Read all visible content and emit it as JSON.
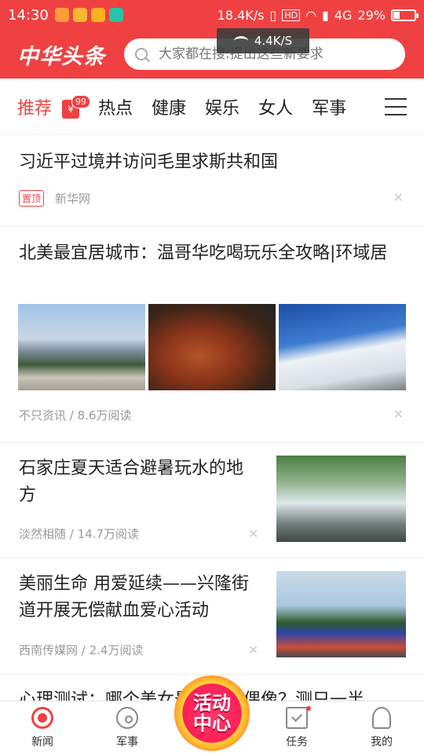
{
  "status_bar": {
    "time": "14:30",
    "net_speed": "18.4K/s",
    "network": "4G",
    "battery": "29%",
    "battery_level": 0.29
  },
  "header": {
    "logo": "中华头条",
    "search_placeholder": "大家都在搜:提出这些新要求"
  },
  "toast": {
    "speed": "4.4K/S"
  },
  "tabs": [
    {
      "label": "推荐",
      "badge": "99"
    },
    {
      "label": "热点"
    },
    {
      "label": "健康"
    },
    {
      "label": "娱乐"
    },
    {
      "label": "女人"
    },
    {
      "label": "军事"
    }
  ],
  "feed": [
    {
      "title": "习近平过境并访问毛里求斯共和国",
      "pin": "置顶",
      "source": "新华网"
    },
    {
      "title": "北美最宜居城市：温哥华吃喝玩乐全攻略|环域居",
      "meta": "不只资讯 / 8.6万阅读",
      "images": [
        "city-fountain-image",
        "bbq-image",
        "snow-hiking-image"
      ]
    },
    {
      "title": "石家庄夏天适合避暑玩水的地方",
      "meta": "淡然相随 / 14.7万阅读",
      "image": "waterfall-image"
    },
    {
      "title": "美丽生命 用爱延续——兴隆街道开展无偿献血爱心活动",
      "meta": "西南传媒网 / 2.4万阅读",
      "image": "blood-donation-tent-image"
    },
    {
      "title": "心理测试：哪个美女最像你的偶像？测只一半"
    }
  ],
  "bottom_nav": [
    {
      "label": "新闻"
    },
    {
      "label": "军事"
    },
    {
      "label": "活动中心"
    },
    {
      "label": "任务"
    },
    {
      "label": "我的"
    }
  ],
  "colors": {
    "brand": "#f04142"
  }
}
